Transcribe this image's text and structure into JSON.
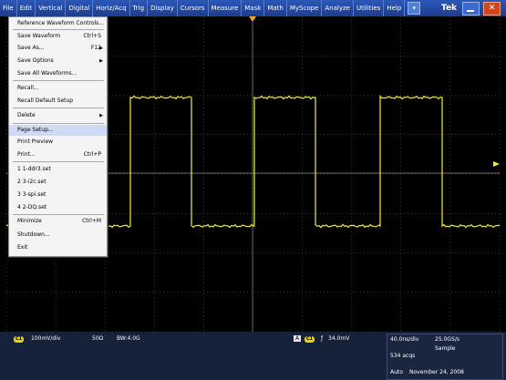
{
  "menubar": {
    "items": [
      "File",
      "Edit",
      "Vertical",
      "Digital",
      "Horiz/Acq",
      "Trig",
      "Display",
      "Cursors",
      "Measure",
      "Mask",
      "Math",
      "MyScope",
      "Analyze",
      "Utilities",
      "Help"
    ],
    "brand": "Tek"
  },
  "file_menu": {
    "items": [
      {
        "label": "Reference Waveform Controls...",
        "shortcut": ""
      },
      {
        "label": "Save Waveform",
        "shortcut": "Ctrl+S"
      },
      {
        "label": "Save As...",
        "shortcut": "F12"
      },
      {
        "label": "Save Options",
        "shortcut": ""
      },
      {
        "label": "Save All Waveforms...",
        "shortcut": ""
      },
      {
        "label": "Recall...",
        "shortcut": ""
      },
      {
        "label": "Recall Default Setup",
        "shortcut": ""
      },
      {
        "label": "Delete",
        "shortcut": ""
      },
      {
        "label": "Page Setup...",
        "shortcut": ""
      },
      {
        "label": "Print Preview",
        "shortcut": ""
      },
      {
        "label": "Print...",
        "shortcut": "Ctrl+P"
      },
      {
        "label": "1 1-ddr3.set",
        "shortcut": ""
      },
      {
        "label": "2 3-i2c.set",
        "shortcut": ""
      },
      {
        "label": "3 3-spi.set",
        "shortcut": ""
      },
      {
        "label": "4 2-DQ.set",
        "shortcut": ""
      },
      {
        "label": "Minimize",
        "shortcut": "Ctrl+M"
      },
      {
        "label": "Shutdown...",
        "shortcut": ""
      },
      {
        "label": "Exit",
        "shortcut": ""
      }
    ],
    "highlighted_label": "Page Setup..."
  },
  "status": {
    "ch1_badge": "C1",
    "ch1_scale": "100mV/div",
    "ch1_impedance": "50Ω",
    "ch1_bw": "BW:4.0G",
    "trig_mode": "A",
    "trig_ch": "C1",
    "trig_level": "34.0mV",
    "horiz": "40.0ns/div",
    "sample_rate": "25.0GS/s",
    "mode": "Sample",
    "acqs": "534 acqs",
    "date_label": "Auto",
    "date": "November 24, 2008"
  },
  "colors": {
    "waveform": "#f2ec3a",
    "grid": "#7a7a7a",
    "menubar": "#2b58b8",
    "status_bg": "#16213a"
  }
}
